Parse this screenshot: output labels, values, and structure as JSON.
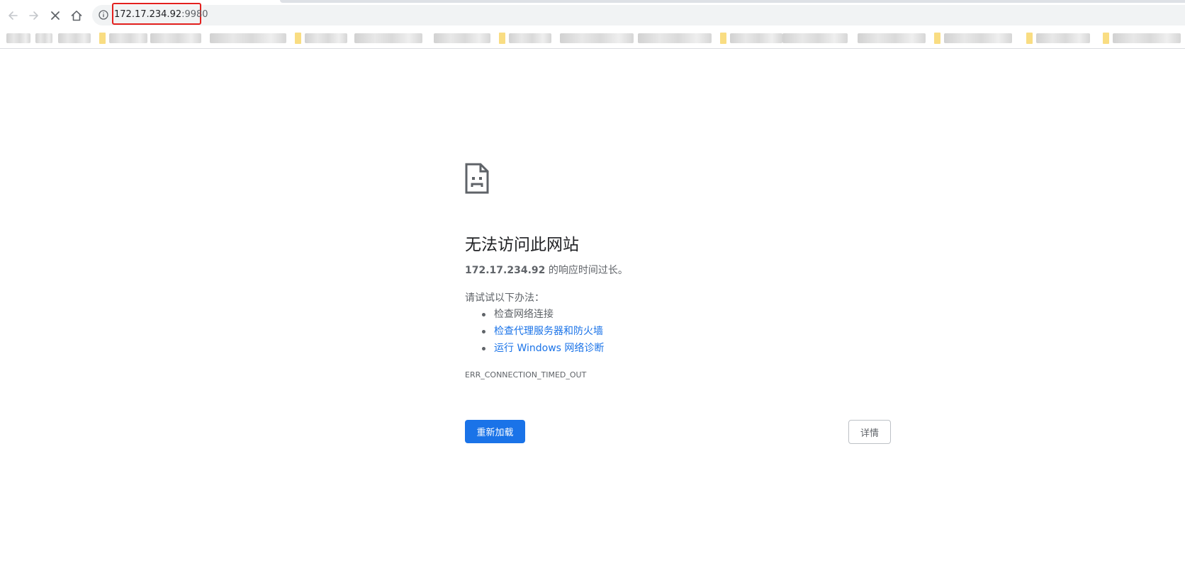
{
  "browser": {
    "back_icon": "back-arrow-icon",
    "forward_icon": "forward-arrow-icon",
    "stop_icon": "stop-x-icon",
    "home_icon": "home-icon",
    "info_icon": "info-icon",
    "address": {
      "host": "172.17.234.92",
      "port": ":9980"
    },
    "highlight_color": "#e3201e",
    "bookmark_folder_color": "#f9dd82"
  },
  "error_page": {
    "icon": "sad-page-icon",
    "heading": "无法访问此网站",
    "desc_host": "172.17.234.92",
    "desc_rest": " 的响应时间过长。",
    "try_label": "请试试以下办法：",
    "suggestions": [
      "检查网络连接",
      "检查代理服务器和防火墙",
      "运行 Windows 网络诊断"
    ],
    "error_code": "ERR_CONNECTION_TIMED_OUT",
    "reload_label": "重新加载",
    "details_label": "详情",
    "accent_color": "#1a73e8"
  }
}
